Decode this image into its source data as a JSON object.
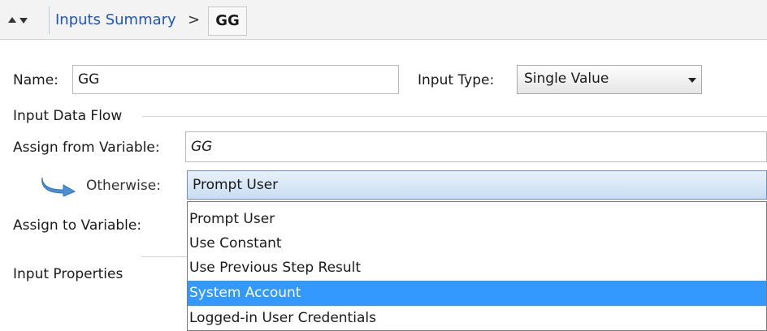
{
  "breadcrumb": {
    "link_label": "Inputs Summary",
    "separator": ">",
    "current": "GG"
  },
  "form": {
    "name_label": "Name:",
    "name_value": "GG",
    "input_type_label": "Input Type:",
    "input_type_value": "Single Value",
    "input_data_flow_label": "Input Data Flow",
    "assign_from_label": "Assign from Variable:",
    "assign_from_value": "GG",
    "otherwise_label": "Otherwise:",
    "otherwise_value": "Prompt User",
    "assign_to_label": "Assign to Variable:",
    "input_properties_label": "Input Properties"
  },
  "dropdown": {
    "options": [
      "Prompt User",
      "Use Constant",
      "Use Previous Step Result",
      "System Account",
      "Logged-in User Credentials"
    ],
    "highlighted": "System Account"
  },
  "colors": {
    "link": "#1f55b8",
    "selection": "#3399ff",
    "combo_border": "#6d8fb8"
  },
  "icons": [
    "nav-up-icon",
    "nav-down-icon",
    "dropdown-arrow-icon",
    "otherwise-arrow-icon"
  ]
}
